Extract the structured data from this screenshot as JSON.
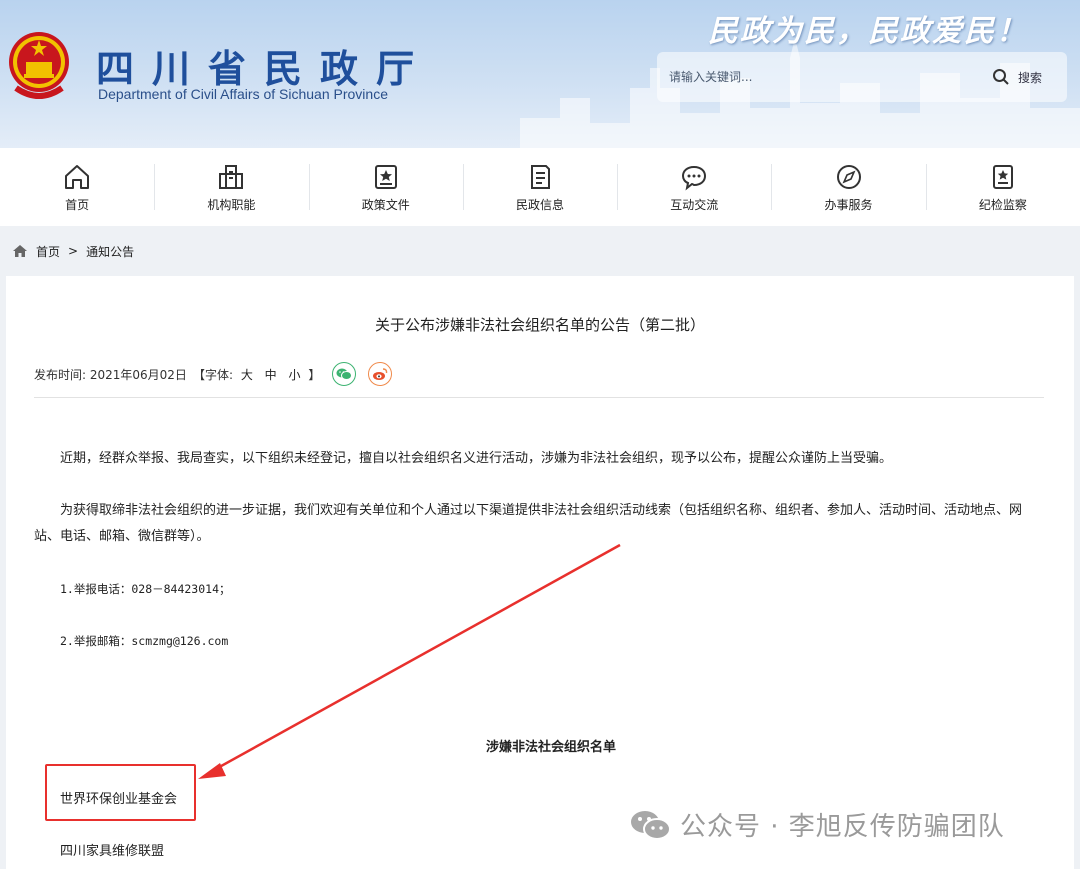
{
  "header": {
    "site_title": "四川省民政厅",
    "site_subtitle": "Department of Civil Affairs of Sichuan Province",
    "slogan": "民政为民，民政爱民！",
    "search_placeholder": "请输入关键词...",
    "search_label": "搜索"
  },
  "nav": {
    "items": [
      {
        "label": "首页",
        "icon": "home-icon"
      },
      {
        "label": "机构职能",
        "icon": "building-icon"
      },
      {
        "label": "政策文件",
        "icon": "star-document-icon"
      },
      {
        "label": "民政信息",
        "icon": "document-icon"
      },
      {
        "label": "互动交流",
        "icon": "chat-icon"
      },
      {
        "label": "办事服务",
        "icon": "compass-icon"
      },
      {
        "label": "纪检监察",
        "icon": "badge-icon"
      }
    ]
  },
  "breadcrumb": {
    "home": "首页",
    "separator": ">",
    "current": "通知公告"
  },
  "article": {
    "title": "关于公布涉嫌非法社会组织名单的公告（第二批）",
    "publish_label": "发布时间: 2021年06月02日",
    "font_size_open": "【字体:",
    "font_sizes": [
      "大",
      "中",
      "小"
    ],
    "font_size_close": "】",
    "paragraph1": "近期，经群众举报、我局查实，以下组织未经登记，擅自以社会组织名义进行活动，涉嫌为非法社会组织，现予以公布，提醒公众谨防上当受骗。",
    "paragraph2": "为获得取缔非法社会组织的进一步证据，我们欢迎有关单位和个人通过以下渠道提供非法社会组织活动线索（包括组织名称、组织者、参加人、活动时间、活动地点、网站、电话、邮箱、微信群等）。",
    "report_phone": "1.举报电话：028－84423014；",
    "report_email": "2.举报邮箱：scmzmg@126.com",
    "list_title": "涉嫌非法社会组织名单",
    "organizations": [
      "世界环保创业基金会",
      "四川家具维修联盟"
    ]
  },
  "watermark": "公众号 · 李旭反传防骗团队",
  "colors": {
    "brand_blue": "#1f4f9c",
    "highlight_red": "#e8302d",
    "wechat_green": "#3cb371",
    "weibo_orange": "#f08a4b"
  }
}
